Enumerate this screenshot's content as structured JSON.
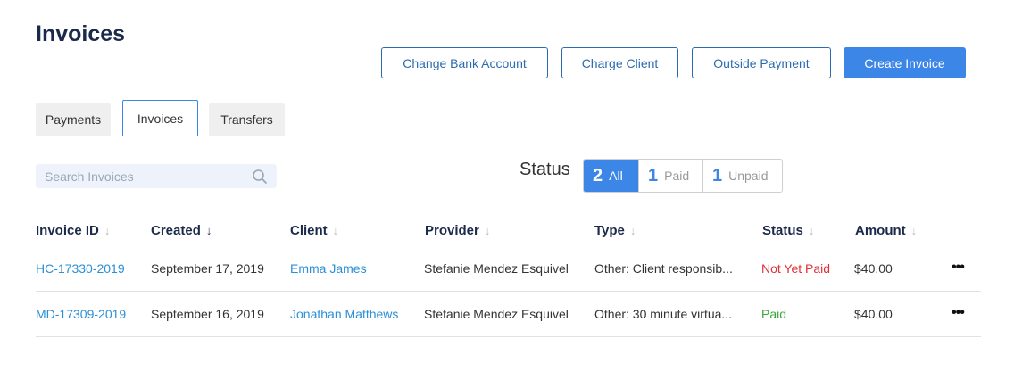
{
  "page": {
    "title": "Invoices"
  },
  "actions": {
    "change_bank_account": "Change Bank Account",
    "charge_client": "Charge Client",
    "outside_payment": "Outside Payment",
    "create_invoice": "Create Invoice"
  },
  "tabs": [
    {
      "label": "Payments",
      "active": false
    },
    {
      "label": "Invoices",
      "active": true
    },
    {
      "label": "Transfers",
      "active": false
    }
  ],
  "search": {
    "placeholder": "Search Invoices",
    "value": ""
  },
  "status_filter": {
    "label": "Status",
    "options": [
      {
        "count": "2",
        "label": "All",
        "active": true
      },
      {
        "count": "1",
        "label": "Paid",
        "active": false
      },
      {
        "count": "1",
        "label": "Unpaid",
        "active": false
      }
    ]
  },
  "table": {
    "columns": [
      {
        "label": "Invoice ID",
        "sort": "none"
      },
      {
        "label": "Created",
        "sort": "desc"
      },
      {
        "label": "Client",
        "sort": "none"
      },
      {
        "label": "Provider",
        "sort": "none"
      },
      {
        "label": "Type",
        "sort": "none"
      },
      {
        "label": "Status",
        "sort": "none"
      },
      {
        "label": "Amount",
        "sort": "none"
      }
    ],
    "rows": [
      {
        "invoice_id": "HC-17330-2019",
        "created": "September 17, 2019",
        "client": "Emma James",
        "provider": "Stefanie Mendez Esquivel",
        "type": "Other: Client responsib...",
        "status": "Not Yet Paid",
        "amount": "$40.00",
        "more": "•••"
      },
      {
        "invoice_id": "MD-17309-2019",
        "created": "September 16, 2019",
        "client": "Jonathan Matthews",
        "provider": "Stefanie Mendez Esquivel",
        "type": "Other: 30 minute virtua...",
        "status": "Paid",
        "amount": "$40.00",
        "more": "•••"
      }
    ]
  },
  "colors": {
    "accent": "#3b86e6",
    "link": "#2b8fd6",
    "status_unpaid": "#e0303a",
    "status_paid": "#38a83d",
    "heading": "#1b2a4a"
  }
}
